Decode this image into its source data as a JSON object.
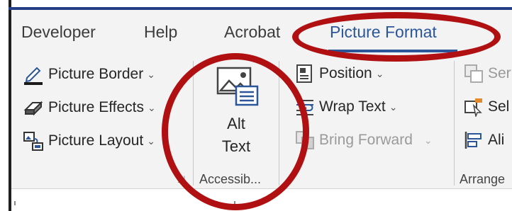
{
  "tabs": [
    {
      "label": "Developer",
      "active": false
    },
    {
      "label": "Help",
      "active": false
    },
    {
      "label": "Acrobat",
      "active": false
    },
    {
      "label": "Picture Format",
      "active": true
    }
  ],
  "picture_styles_commands": {
    "picture_border": "Picture Border",
    "picture_effects": "Picture Effects",
    "picture_layout": "Picture Layout"
  },
  "accessibility": {
    "alt_text_line1": "Alt",
    "alt_text_line2": "Text",
    "group_label": "Accessib..."
  },
  "arrange_commands": {
    "position": "Position",
    "wrap_text": "Wrap Text",
    "bring_forward": "Bring Forward",
    "send_backward_partial": "Ser",
    "selection_pane_partial": "Sel",
    "align_partial": "Ali",
    "group_label": "Arrange"
  },
  "caret_glyph": "⌄",
  "colors": {
    "accent": "#2b579a",
    "annotation_red": "#b01012",
    "ribbon_bg": "#f3f3f3"
  }
}
